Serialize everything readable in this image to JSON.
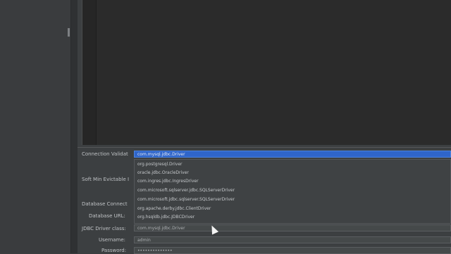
{
  "form": {
    "connection_validation_label": "Connection Validat",
    "connection_validation_value": "com.mysql.jdbc.Driver",
    "soft_min_label": "Soft Min Evictable I",
    "database_connection_label": "Database Connect",
    "database_url_label": "Database URL:",
    "jdbc_driver_class_label": "JDBC Driver class:",
    "jdbc_driver_class_value": "com.mysql.jdbc.Driver",
    "username_label": "Username:",
    "username_value": "admin",
    "password_label": "Password:",
    "password_value": "••••••••••••••"
  },
  "dropdown": {
    "options": [
      "org.postgresql.Driver",
      "oracle.jdbc.OracleDriver",
      "com.ingres.jdbc.IngresDriver",
      "com.microsoft.sqlserver.jdbc.SQLServerDriver",
      "com.microsoft.jdbc.sqlserver.SQLServerDriver",
      "org.apache.derby.jdbc.ClientDriver",
      "org.hsqldb.jdbc.JDBCDriver"
    ]
  },
  "colors": {
    "selection": "#2f65ca",
    "background": "#3c3f41",
    "editor": "#2b2b2b"
  }
}
